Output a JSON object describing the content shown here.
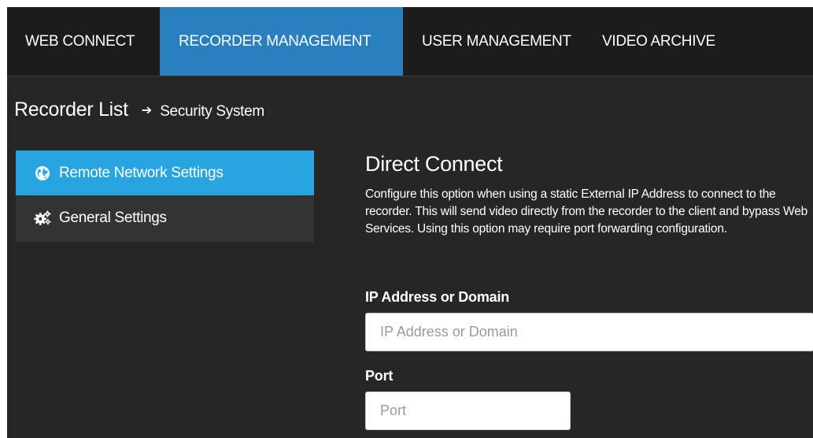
{
  "topnav": {
    "tabs": [
      {
        "label": "WEB CONNECT",
        "active": false
      },
      {
        "label": "RECORDER MANAGEMENT",
        "active": true
      },
      {
        "label": "USER MANAGEMENT",
        "active": false
      },
      {
        "label": "VIDEO ARCHIVE",
        "active": false
      }
    ]
  },
  "breadcrumb": {
    "root": "Recorder List",
    "separator": "➔",
    "current": "Security System"
  },
  "sidebar": {
    "items": [
      {
        "label": "Remote Network Settings",
        "icon": "globe-icon",
        "active": true
      },
      {
        "label": "General Settings",
        "icon": "gears-icon",
        "active": false
      }
    ]
  },
  "main": {
    "title": "Direct Connect",
    "description": "Configure this option when using a static External IP Address to connect to the recorder. This will send video directly from the recorder to the client and bypass Web Services. Using this option may require port forwarding configuration.",
    "fields": {
      "ip": {
        "label": "IP Address or Domain",
        "placeholder": "IP Address or Domain",
        "value": ""
      },
      "port": {
        "label": "Port",
        "placeholder": "Port",
        "value": ""
      }
    }
  },
  "colors": {
    "nav_bg": "#1c1c1c",
    "nav_active": "#2a7fbf",
    "page_bg": "#262626",
    "sidebar_bg": "#333333",
    "sidebar_active": "#28a4e0"
  }
}
